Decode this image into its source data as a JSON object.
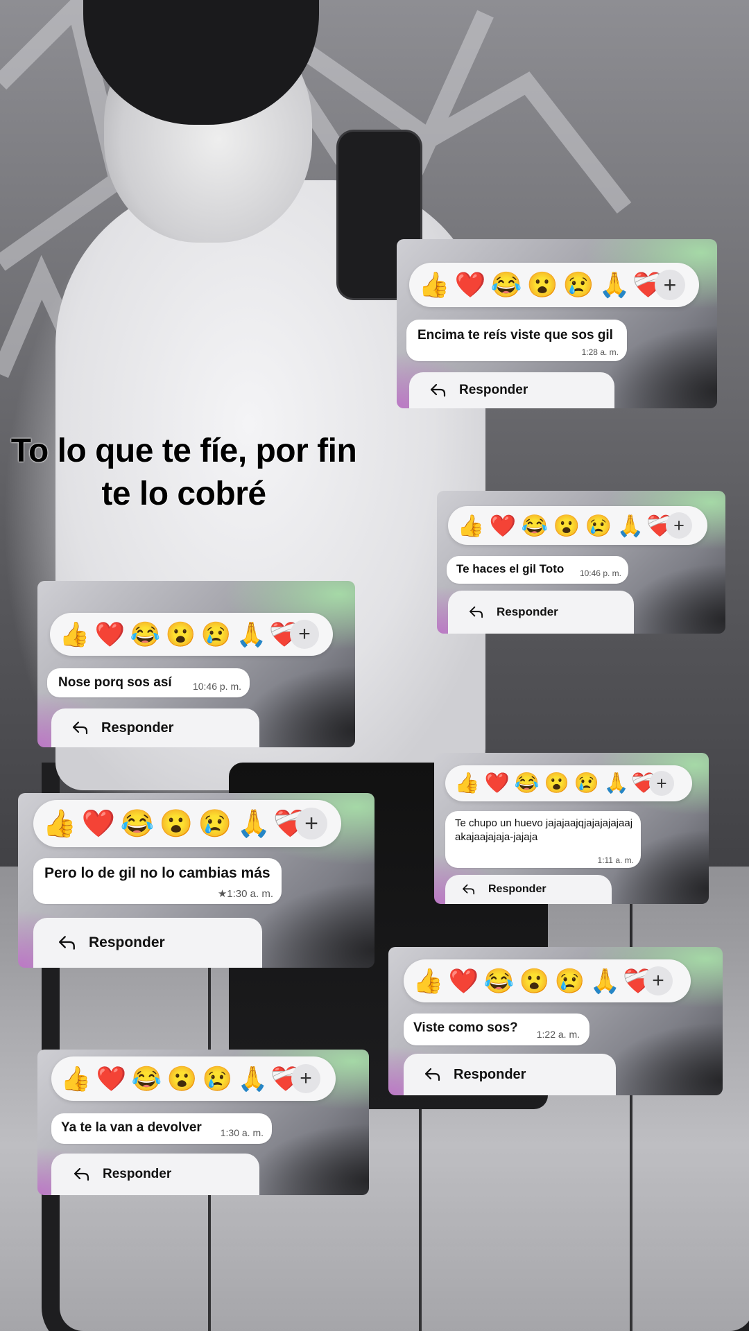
{
  "caption": "To lo que te fíe, por fin te lo cobré",
  "reactions": [
    "👍",
    "❤️",
    "😂",
    "😮",
    "😢",
    "🙏",
    "❤️‍🩹"
  ],
  "add_symbol": "+",
  "reply_label": "Responder",
  "messages": [
    {
      "text": "Encima te reís viste que sos gil",
      "time": "1:28 a. m."
    },
    {
      "text": "Te haces el gil Toto",
      "time": "10:46 p. m."
    },
    {
      "text": "Nose porq sos así",
      "time": "10:46 p. m."
    },
    {
      "text": "Te chupo un huevo jajajaajqjajajajajaajakajaajajaja-jajaja",
      "time": "1:11 a. m."
    },
    {
      "text": "Pero lo de gil no lo cambias más",
      "time": "★1:30 a. m."
    },
    {
      "text": "Viste como sos?",
      "time": "1:22 a. m."
    },
    {
      "text": "Ya te la van a devolver",
      "time": "1:30 a. m."
    }
  ]
}
